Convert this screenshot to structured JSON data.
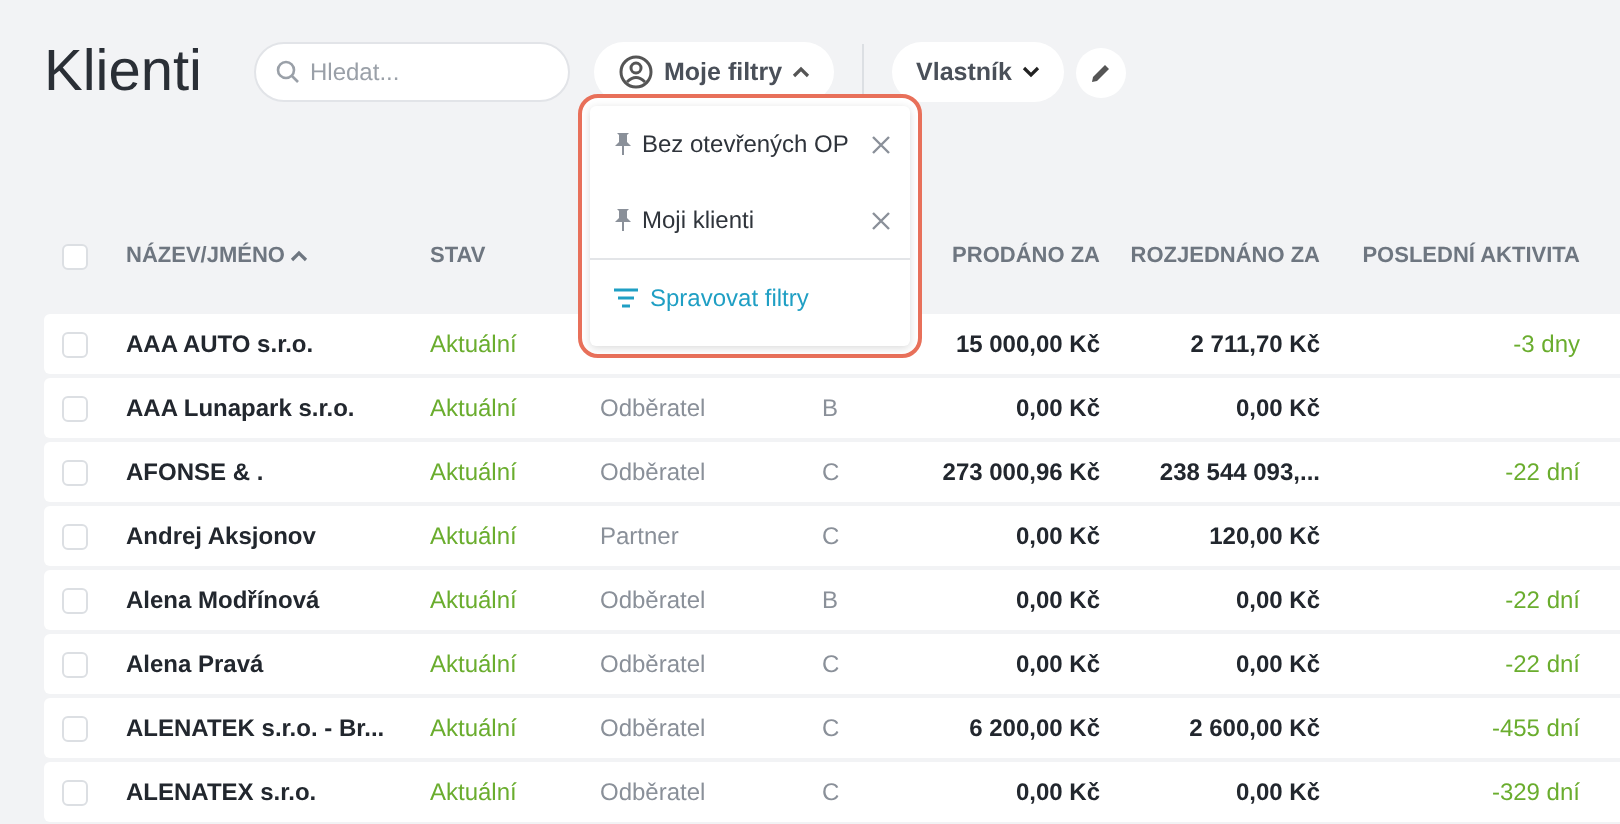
{
  "title": "Klienti",
  "search": {
    "placeholder": "Hledat..."
  },
  "filters_button": {
    "label": "Moje filtry",
    "expanded": true
  },
  "owner_button": {
    "label": "Vlastník"
  },
  "filters_menu": {
    "items": [
      {
        "label": "Bez otevřených OP"
      },
      {
        "label": "Moji klienti"
      }
    ],
    "manage_link": "Spravovat filtry"
  },
  "table": {
    "all_checked": false,
    "columns": [
      {
        "label": "NÁZEV/JMÉNO",
        "sorted": true
      },
      {
        "label": "STAV",
        "sorted": false
      },
      {
        "label": "PRODÁNO ZA",
        "sorted": false
      },
      {
        "label": "ROZJEDNÁNO ZA",
        "sorted": false
      },
      {
        "label": "POSLEDNÍ AKTIVITA",
        "sorted": false
      }
    ],
    "rows": [
      {
        "checked": false,
        "name": "AAA AUTO s.r.o.",
        "status": "Aktuální",
        "sold": "15 000,00 Kč",
        "negotiated": "2 711,70 Kč",
        "activity": "-3 dny"
      },
      {
        "checked": false,
        "name": "AAA Lunapark s.r.o.",
        "status": "Aktuální",
        "type": "Odběratel",
        "category": "B",
        "sold": "0,00 Kč",
        "negotiated": "0,00 Kč"
      },
      {
        "checked": false,
        "name": "AFONSE & .",
        "status": "Aktuální",
        "type": "Odběratel",
        "category": "C",
        "sold": "273 000,96 Kč",
        "negotiated": "238 544 093,...",
        "activity": "-22 dní"
      },
      {
        "checked": false,
        "name": "Andrej Aksjonov",
        "status": "Aktuální",
        "type": "Partner",
        "category": "C",
        "sold": "0,00 Kč",
        "negotiated": "120,00 Kč"
      },
      {
        "checked": false,
        "name": "Alena Modřínová",
        "status": "Aktuální",
        "type": "Odběratel",
        "category": "B",
        "sold": "0,00 Kč",
        "negotiated": "0,00 Kč",
        "activity": "-22 dní"
      },
      {
        "checked": false,
        "name": "Alena Pravá",
        "status": "Aktuální",
        "type": "Odběratel",
        "category": "C",
        "sold": "0,00 Kč",
        "negotiated": "0,00 Kč",
        "activity": "-22 dní"
      },
      {
        "checked": false,
        "name": "ALENATEK s.r.o. - Br...",
        "status": "Aktuální",
        "type": "Odběratel",
        "category": "C",
        "sold": "6 200,00 Kč",
        "negotiated": "2 600,00 Kč",
        "activity": "-455 dní"
      },
      {
        "checked": false,
        "name": "ALENATEX s.r.o.",
        "status": "Aktuální",
        "type": "Odběratel",
        "category": "C",
        "sold": "0,00 Kč",
        "negotiated": "0,00 Kč",
        "activity": "-329 dní"
      }
    ]
  }
}
